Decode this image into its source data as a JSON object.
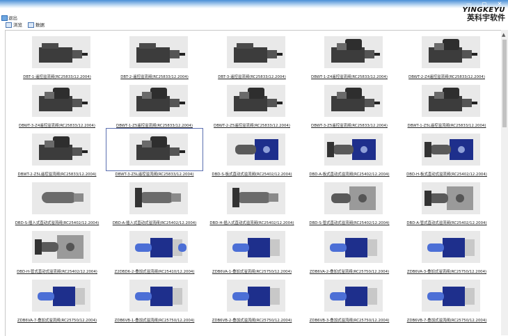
{
  "brand": {
    "logo_en": "YINGKEYU",
    "logo_cn": "英科宇软件"
  },
  "toolbar": {
    "exit_label": "退出"
  },
  "tabs": [
    {
      "label": "浏览"
    },
    {
      "label": "数据"
    }
  ],
  "colors": {
    "valve_dark": "#3c3c3c",
    "valve_blue": "#1e2f8c",
    "selection": "#5b6fb0"
  },
  "items": [
    {
      "label": "DBT-1-遥控溢流阀(RC25833/12.2004)",
      "kind": "dark-remote"
    },
    {
      "label": "DBT-2-遥控溢流阀(RC25833/12.2004)",
      "kind": "dark-remote"
    },
    {
      "label": "DBT-3-遥控溢流阀(RC25833/12.2004)",
      "kind": "dark-remote"
    },
    {
      "label": "DBWT-1-Z4遥控溢流阀(RC25833/12.2004)",
      "kind": "dark-solenoid"
    },
    {
      "label": "DBWT-2-Z4遥控溢流阀(RC25833/12.2004)",
      "kind": "dark-solenoid"
    },
    {
      "label": "DBWT-3-Z4遥控溢流阀(RC25833/12.2004)",
      "kind": "dark-solenoid"
    },
    {
      "label": "DBWT-1-Z5遥控溢流阀(RC25833/12.2004)",
      "kind": "dark-solenoid"
    },
    {
      "label": "DBWT-2-Z5遥控溢流阀(RC25833/12.2004)",
      "kind": "dark-solenoid"
    },
    {
      "label": "DBWT-3-Z5遥控溢流阀(RC25833/12.2004)",
      "kind": "dark-solenoid"
    },
    {
      "label": "DBWT-1-Z5L遥控溢流阀(RC25833/12.2004)",
      "kind": "dark-solenoid"
    },
    {
      "label": "DBWT-2-Z5L遥控溢流阀(RC25833/12.2004)",
      "kind": "dark-solenoid"
    },
    {
      "label": "DBWT-3-Z5L遥控溢流阀(RC25833/12.2004)",
      "kind": "dark-solenoid",
      "selected": true
    },
    {
      "label": "DBD-S-板式直动式溢流阀(RC25402/12.2004)",
      "kind": "blue-plate"
    },
    {
      "label": "DBD-A-板式直动式溢流阀(RC25402/12.2004)",
      "kind": "blue-plate-knob"
    },
    {
      "label": "DBD-H-板式直动式溢流阀(RC25402/12.2004)",
      "kind": "blue-plate-knob"
    },
    {
      "label": "DBD-S-插入式直动式溢流阀(RC25402/12.2004)",
      "kind": "cartridge"
    },
    {
      "label": "DBD-A-插入式直动式溢流阀(RC25402/12.2004)",
      "kind": "cartridge-knob"
    },
    {
      "label": "DBD-H-插入式直动式溢流阀(RC25402/12.2004)",
      "kind": "cartridge-knob"
    },
    {
      "label": "DBD-S-管式直动式溢流阀(RC25402/12.2004)",
      "kind": "pipe"
    },
    {
      "label": "DBD-A-管式直动式溢流阀(RC25402/12.2004)",
      "kind": "pipe-knob"
    },
    {
      "label": "DBD-H-管式直动式溢流阀(RC25402/12.2004)",
      "kind": "pipe-knob"
    },
    {
      "label": "Z2DBD6-2-叠加式溢流阀(RC25410/12.2004)",
      "kind": "stack-double"
    },
    {
      "label": "ZDB6VA-1-叠加式溢流阀(RC25750/12.2004)",
      "kind": "stack"
    },
    {
      "label": "ZDB6VA-2-叠加式溢流阀(RC25750/12.2004)",
      "kind": "stack"
    },
    {
      "label": "ZDB6VA-3-叠加式溢流阀(RC25750/12.2004)",
      "kind": "stack"
    },
    {
      "label": "ZDB6VA-7-叠加式溢流阀(RC25750/12.2004)",
      "kind": "stack"
    },
    {
      "label": "ZDB6VB-1-叠加式溢流阀(RC25750/12.2004)",
      "kind": "stack"
    },
    {
      "label": "ZDB6VB-2-叠加式溢流阀(RC25750/12.2004)",
      "kind": "stack"
    },
    {
      "label": "ZDB6VB-3-叠加式溢流阀(RC25750/12.2004)",
      "kind": "stack"
    },
    {
      "label": "ZDB6VB-7-叠加式溢流阀(RC25750/12.2004)",
      "kind": "stack"
    }
  ]
}
